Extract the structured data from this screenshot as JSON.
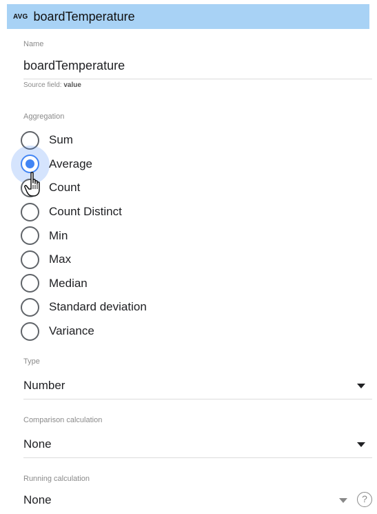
{
  "header": {
    "badge": "AVG",
    "title": "boardTemperature"
  },
  "name_field": {
    "label": "Name",
    "value": "boardTemperature",
    "source_prefix": "Source field: ",
    "source_value": "value"
  },
  "aggregation": {
    "label": "Aggregation",
    "options": [
      "Sum",
      "Average",
      "Count",
      "Count Distinct",
      "Min",
      "Max",
      "Median",
      "Standard deviation",
      "Variance"
    ],
    "selected": "Average"
  },
  "type_field": {
    "label": "Type",
    "value": "Number"
  },
  "comparison_field": {
    "label": "Comparison calculation",
    "value": "None"
  },
  "running_field": {
    "label": "Running calculation",
    "value": "None",
    "help_glyph": "?"
  },
  "colors": {
    "header_bg": "#a8d2f5",
    "accent": "#4285f4"
  }
}
